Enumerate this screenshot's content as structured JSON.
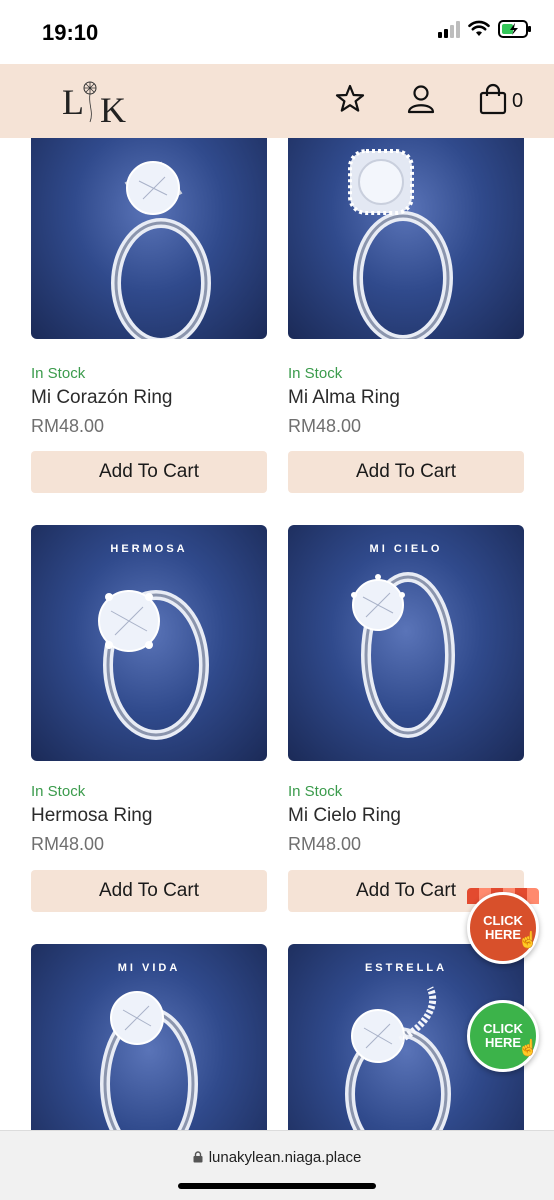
{
  "status_bar": {
    "time": "19:10"
  },
  "header": {
    "logo_text": "L K",
    "cart_count": "0"
  },
  "colors": {
    "header_bg": "#f5e3d6",
    "in_stock": "#3b9b4c",
    "button_bg": "#f5e3d6",
    "float_red": "#d8502b",
    "float_green": "#3cb34a"
  },
  "products": [
    {
      "caption": "",
      "stock": "In Stock",
      "name": "Mi Corazón Ring",
      "price": "RM48.00",
      "button": "Add To Cart"
    },
    {
      "caption": "",
      "stock": "In Stock",
      "name": "Mi Alma Ring",
      "price": "RM48.00",
      "button": "Add To Cart"
    },
    {
      "caption": "HERMOSA",
      "stock": "In Stock",
      "name": "Hermosa Ring",
      "price": "RM48.00",
      "button": "Add To Cart"
    },
    {
      "caption": "MI CIELO",
      "stock": "In Stock",
      "name": "Mi Cielo Ring",
      "price": "RM48.00",
      "button": "Add To Cart"
    },
    {
      "caption": "MI VIDA",
      "stock": "",
      "name": "",
      "price": "",
      "button": ""
    },
    {
      "caption": "ESTRELLA",
      "stock": "",
      "name": "",
      "price": "",
      "button": ""
    }
  ],
  "floating": {
    "red_label": "CLICK HERE",
    "green_label": "CLICK HERE"
  },
  "url_bar": {
    "url": "lunakylean.niaga.place"
  }
}
